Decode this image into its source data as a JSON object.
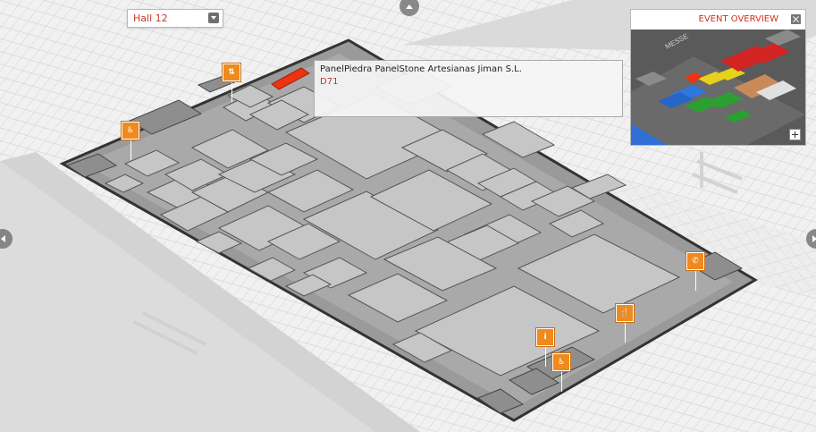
{
  "hall_selector": {
    "label": "Hall 12"
  },
  "tooltip": {
    "exhibitor": "PanelPiedra PanelStone Artesianas Jiman S.L.",
    "booth": "D71"
  },
  "overview": {
    "title": "EVENT OVERVIEW"
  },
  "colors": {
    "accent": "#d0321b",
    "selected_booth": "#ee3311",
    "poi": "#ef8a1e",
    "booth_fill": "#c8c8c8",
    "hall_fill": "#b4b4b4",
    "aisle_fill": "#999999"
  },
  "icons": {
    "poi_list": [
      "elevator-icon",
      "wc-accessible-icon",
      "phone-icon",
      "restaurant-icon",
      "info-icon",
      "wc-accessible-icon"
    ],
    "nav": [
      "arrow-up-icon",
      "arrow-left-icon",
      "arrow-right-icon"
    ]
  }
}
